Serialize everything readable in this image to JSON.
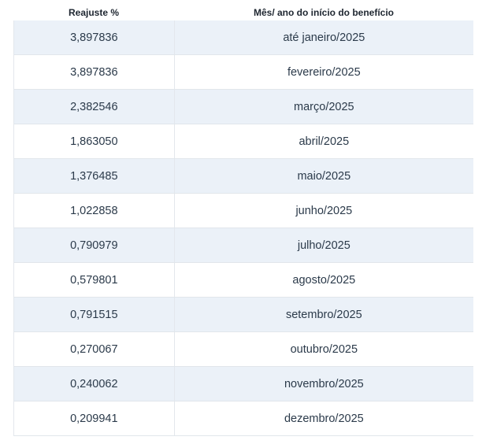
{
  "table": {
    "headers": {
      "reajuste": "Reajuste %",
      "mes_ano": "Mês/ ano do início do benefício"
    },
    "rows": [
      {
        "reajuste": "3,897836",
        "mes_ano": "até janeiro/2025"
      },
      {
        "reajuste": "3,897836",
        "mes_ano": "fevereiro/2025"
      },
      {
        "reajuste": "2,382546",
        "mes_ano": "março/2025"
      },
      {
        "reajuste": "1,863050",
        "mes_ano": "abril/2025"
      },
      {
        "reajuste": "1,376485",
        "mes_ano": "maio/2025"
      },
      {
        "reajuste": "1,022858",
        "mes_ano": "junho/2025"
      },
      {
        "reajuste": "0,790979",
        "mes_ano": "julho/2025"
      },
      {
        "reajuste": "0,579801",
        "mes_ano": "agosto/2025"
      },
      {
        "reajuste": "0,791515",
        "mes_ano": "setembro/2025"
      },
      {
        "reajuste": "0,270067",
        "mes_ano": "outubro/2025"
      },
      {
        "reajuste": "0,240062",
        "mes_ano": "novembro/2025"
      },
      {
        "reajuste": "0,209941",
        "mes_ano": "dezembro/2025"
      }
    ]
  }
}
